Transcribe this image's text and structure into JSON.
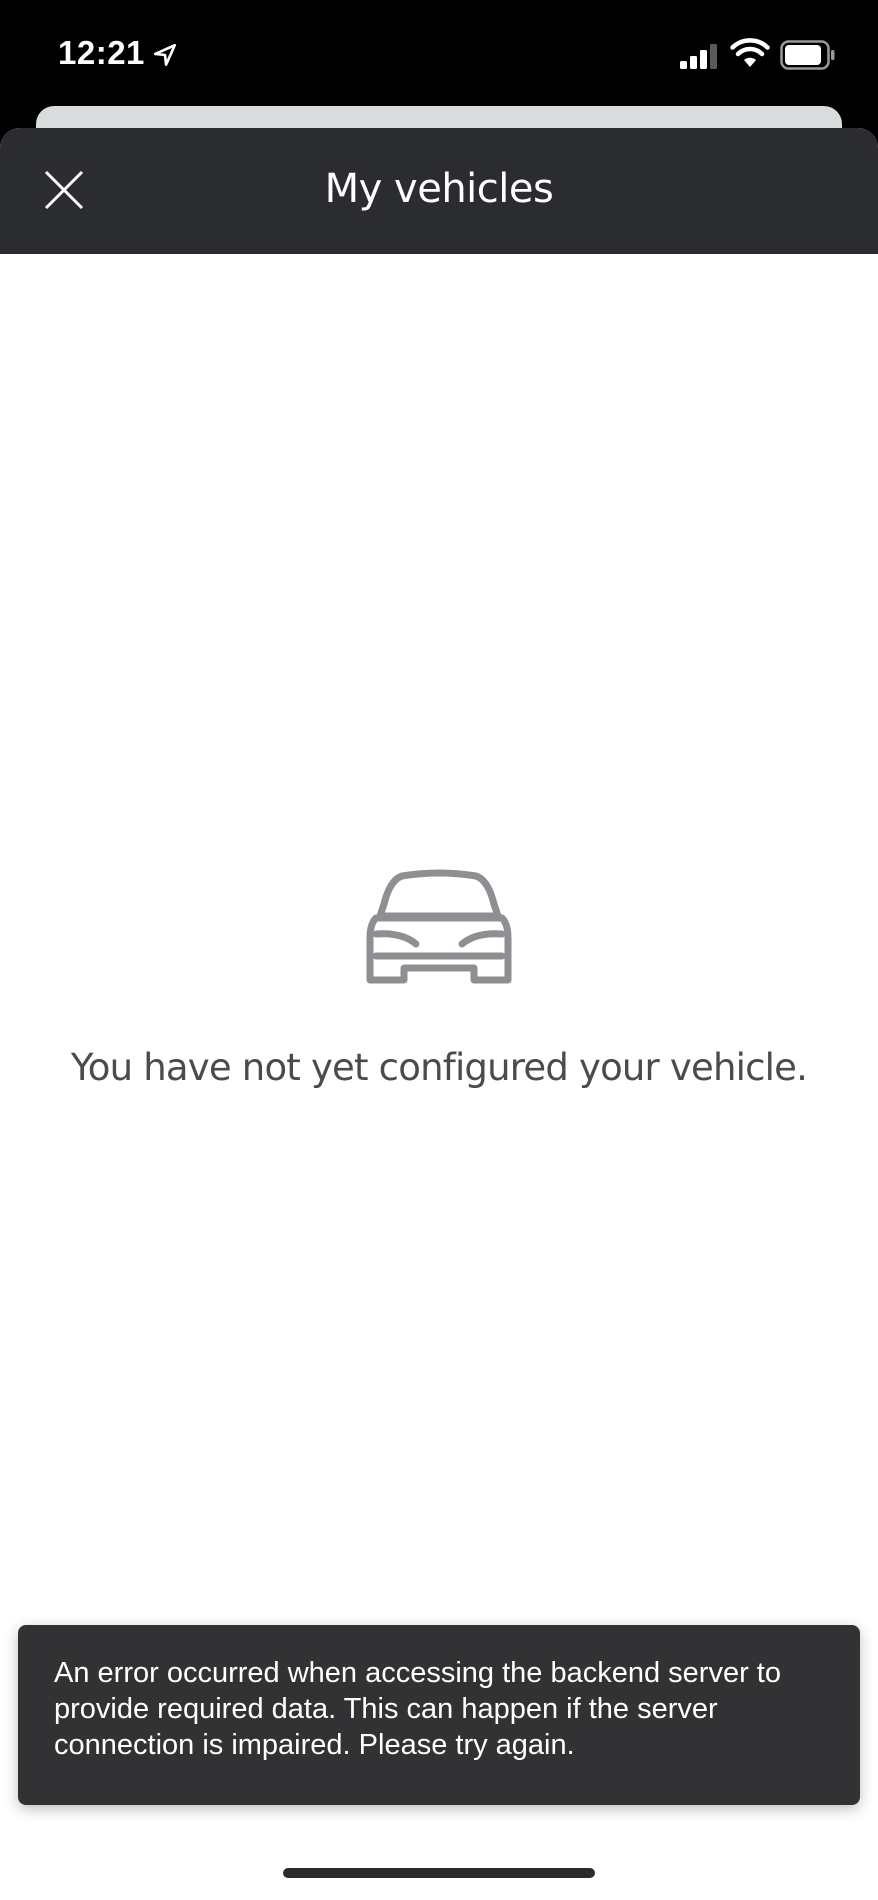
{
  "status_bar": {
    "time": "12:21",
    "icons": [
      "location-arrow-icon",
      "signal-icon",
      "wifi-icon",
      "battery-icon"
    ]
  },
  "header": {
    "title": "My vehicles",
    "close_icon": "close-icon"
  },
  "empty_state": {
    "icon": "car-icon",
    "message": "You have not yet configured your vehicle."
  },
  "toast": {
    "message": "An error occurred when accessing the backend server to provide required data. This can happen if the server connection is impaired. Please try again."
  },
  "colors": {
    "header_bg": "#2b2c2f",
    "toast_bg": "#323234",
    "icon_gray": "#8e8f93",
    "text_gray": "#4a4b4e"
  }
}
